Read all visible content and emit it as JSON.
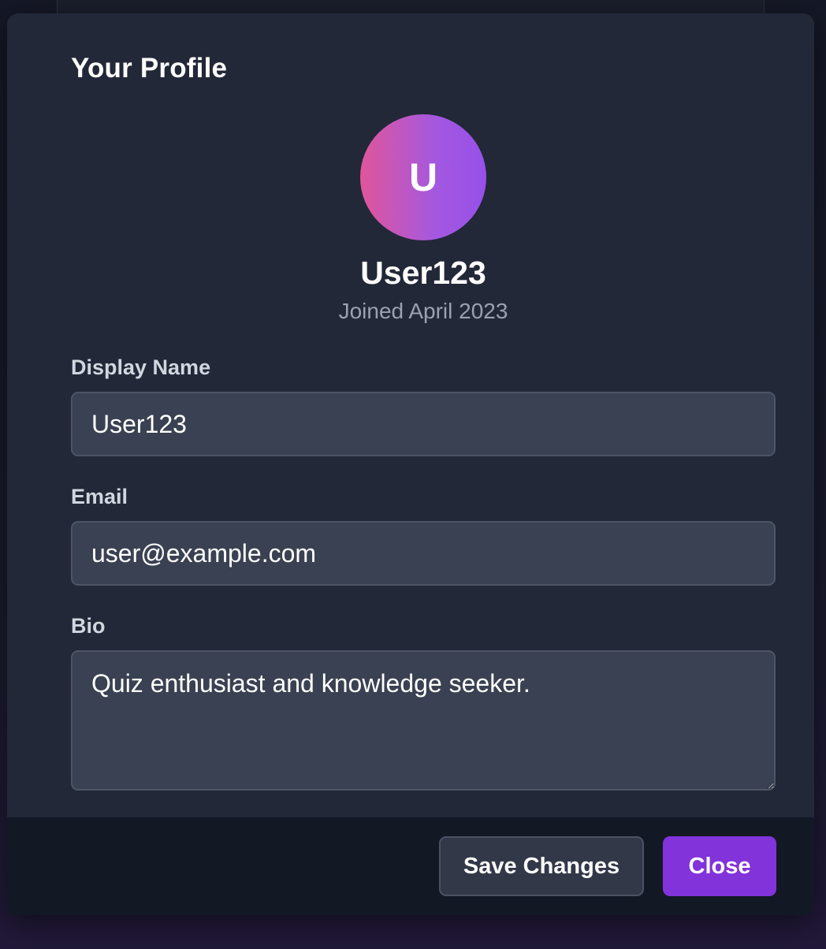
{
  "modal": {
    "title": "Your Profile"
  },
  "profile": {
    "avatar_initial": "U",
    "username": "User123",
    "joined": "Joined April 2023"
  },
  "form": {
    "display_name_label": "Display Name",
    "display_name_value": "User123",
    "email_label": "Email",
    "email_value": "user@example.com",
    "bio_label": "Bio",
    "bio_value": "Quiz enthusiast and knowledge seeker."
  },
  "footer": {
    "save_label": "Save Changes",
    "close_label": "Close"
  },
  "colors": {
    "accent": "#8233d9",
    "avatar_gradient_start": "#e0569a",
    "avatar_gradient_end": "#9650ea",
    "modal_background": "#222837",
    "footer_background": "#131825"
  }
}
